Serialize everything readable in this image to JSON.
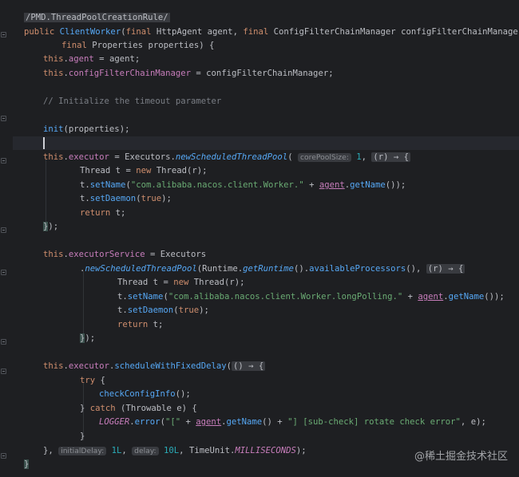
{
  "editor": {
    "annotation": "/PMD.ThreadPoolCreationRule/",
    "ctor_name": "ClientWorker",
    "p1_type": "HttpAgent",
    "p1_name": "agent",
    "p2_type": "ConfigFilterChainManager",
    "p2_name": "configFilterChainManager",
    "p3_type": "Properties",
    "p3_name": "properties",
    "f_agent": "agent",
    "f_cfcm": "configFilterChainManager",
    "comment": "// Initialize the timeout parameter",
    "init_fn": "init",
    "f_executor": "executor",
    "executors": "Executors",
    "new_sched": "newScheduledThreadPool",
    "hint_core": "corePoolSize:",
    "num_one": "1",
    "lambda_r": "(r) → {",
    "thread_type": "Thread",
    "var_t": "t",
    "set_name": "setName",
    "str_worker": "\"com.alibaba.nacos.client.Worker.\"",
    "get_name": "getName",
    "set_daemon": "setDaemon",
    "kw_true": "true",
    "f_executor_service": "executorService",
    "runtime": "Runtime",
    "get_runtime": "getRuntime",
    "avail_proc": "availableProcessors",
    "str_long_polling": "\"com.alibaba.nacos.client.Worker.longPolling.\"",
    "schedule": "scheduleWithFixedDelay",
    "lambda_empty": "() → {",
    "check_config": "checkConfigInfo",
    "throwable": "Throwable",
    "var_e": "e",
    "logger": "LOGGER",
    "error_fn": "error",
    "str_bracket": "\"[\"",
    "str_subcheck": "\"] [sub-check] rotate check error\"",
    "hint_initial": "initialDelay:",
    "num_1l": "1L",
    "hint_delay": "delay:",
    "num_10l": "10L",
    "time_unit": "TimeUnit",
    "millis": "MILLISECONDS"
  },
  "watermark": "@稀土掘金技术社区"
}
